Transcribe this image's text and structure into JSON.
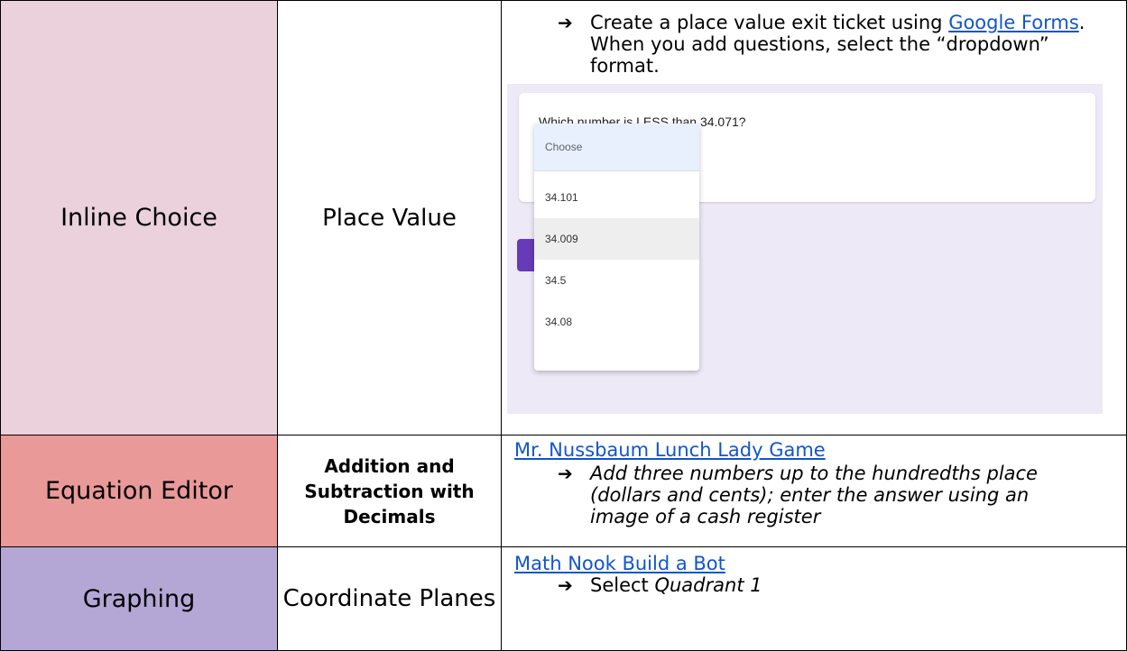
{
  "rows": [
    {
      "type": "Inline Choice",
      "topic": "Place Value",
      "type_bg": "#ead1dc",
      "text_before": "Create a place value exit ticket using ",
      "link": "Google Forms",
      "text_after": ". When you add questions, select the “dropdown” format.",
      "form": {
        "question": "Which number is LESS than 34.071?",
        "dropdown_placeholder": "Choose",
        "options": [
          "34.101",
          "34.009",
          "34.5",
          "34.08"
        ],
        "selected_index": 1,
        "button_color": "#673ab7",
        "background": "#ede9f6"
      }
    },
    {
      "type": "Equation Editor",
      "topic": "Addition and Subtraction with Decimals",
      "type_bg": "#ea9999",
      "link": "Mr. Nussbaum Lunch Lady Game",
      "bullet": "Add three numbers up to the hundredths place (dollars and cents); enter the answer using an image of a cash register"
    },
    {
      "type": "Graphing",
      "topic": "Coordinate Planes",
      "type_bg": "#b4a7d6",
      "link": "Math Nook Build a Bot",
      "bullet_prefix": "Select ",
      "bullet_italic": "Quadrant 1"
    }
  ],
  "colors": {
    "link": "#1155cc"
  },
  "icons": {
    "bullet": "arrow-right-icon"
  }
}
